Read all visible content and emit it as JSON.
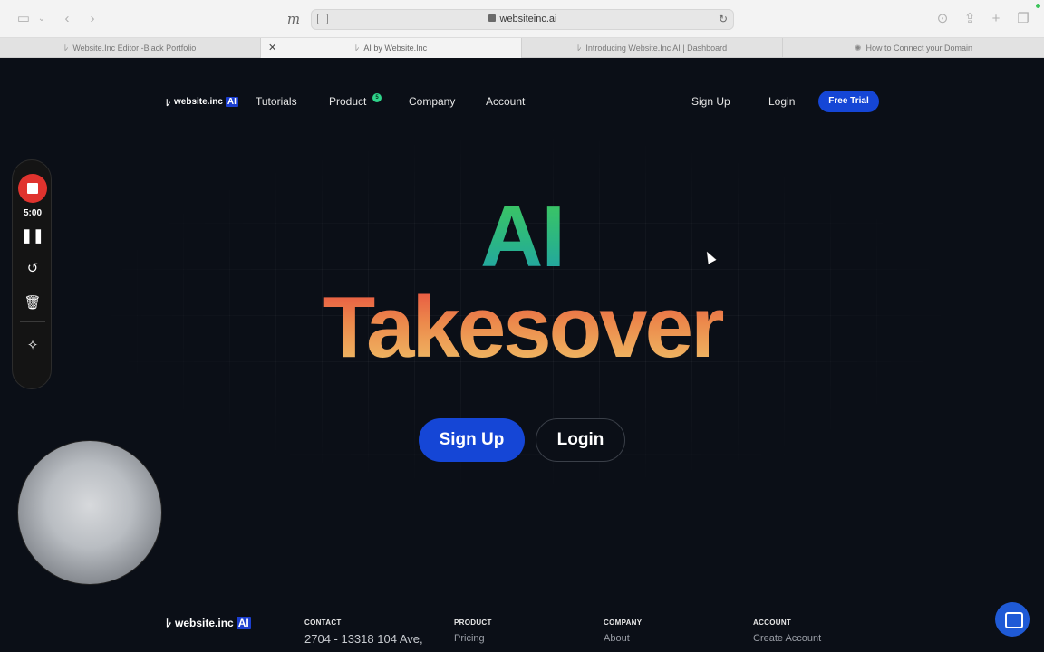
{
  "browser": {
    "url": "websiteinc.ai",
    "tabs": [
      {
        "title": "Website.Inc Editor -Black Portfolio",
        "active": false
      },
      {
        "title": "AI by Website.Inc",
        "active": true
      },
      {
        "title": "Introducing Website.Inc AI | Dashboard",
        "active": false
      },
      {
        "title": "How to Connect your Domain",
        "active": false
      }
    ]
  },
  "header": {
    "logo_text": "website.inc",
    "logo_ai": "AI",
    "nav": [
      "Tutorials",
      "Product",
      "Company",
      "Account"
    ],
    "product_badge": "5",
    "sign_up": "Sign Up",
    "login": "Login",
    "free_trial": "Free Trial"
  },
  "hero": {
    "line1": "AI",
    "line2": "Takesover",
    "cta_signup": "Sign Up",
    "cta_login": "Login"
  },
  "footer": {
    "logo_text": "website.inc",
    "logo_ai": "AI",
    "contact_heading": "CONTACT",
    "contact_address": "2704 - 13318 104 Ave,",
    "product_heading": "PRODUCT",
    "product_link": "Pricing",
    "company_heading": "COMPANY",
    "company_link": "About",
    "account_heading": "ACCOUNT",
    "account_link": "Create Account"
  },
  "recorder": {
    "time": "5:00"
  },
  "colors": {
    "accent_blue": "#1546d6",
    "record_red": "#e0332e",
    "page_bg": "#0b0f17"
  }
}
